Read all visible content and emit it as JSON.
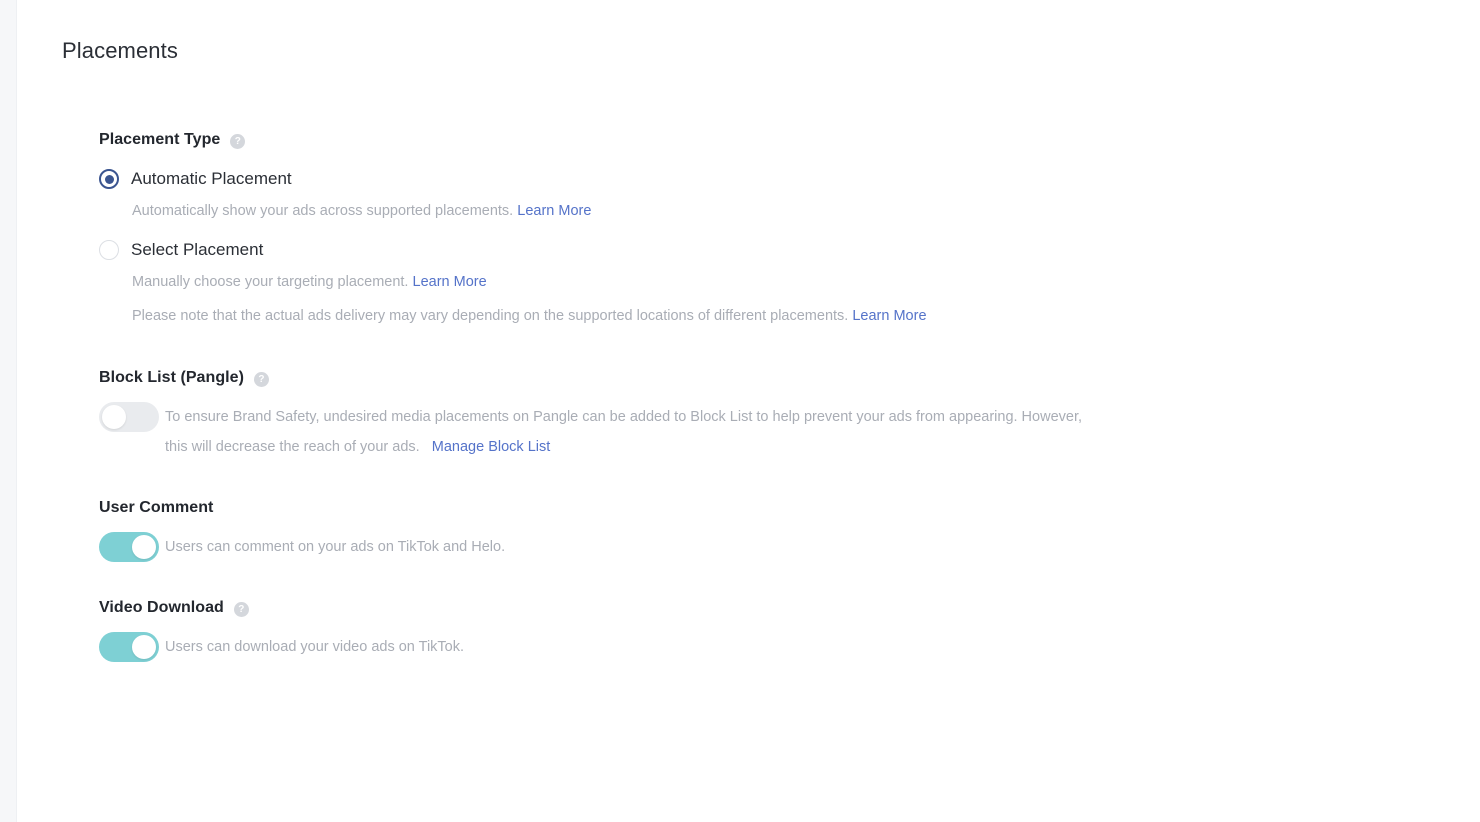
{
  "section": {
    "title": "Placements"
  },
  "placement_type": {
    "label": "Placement Type",
    "help_icon": "help-circle-icon",
    "options": [
      {
        "label": "Automatic Placement",
        "selected": true,
        "hint_text": "Automatically show your ads across supported placements.",
        "hint_link": "Learn More"
      },
      {
        "label": "Select Placement",
        "selected": false,
        "hint_text": "Manually choose your targeting placement.",
        "hint_link": "Learn More"
      }
    ],
    "note_text": "Please note that the actual ads delivery may vary depending on the supported locations of different placements.",
    "note_link": "Learn More"
  },
  "block_list": {
    "label": "Block List (Pangle)",
    "help_icon": "help-circle-icon",
    "toggle_state": "off",
    "description_line1": "To ensure Brand Safety, undesired media placements on Pangle can be added to Block List to help prevent your ads from appearing. However,",
    "description_line2": "this will decrease the reach of your ads.",
    "manage_link": "Manage Block List"
  },
  "user_comment": {
    "label": "User Comment",
    "toggle_state": "on",
    "description": "Users can comment on your ads on TikTok and Helo."
  },
  "video_download": {
    "label": "Video Download",
    "help_icon": "help-circle-icon",
    "toggle_state": "on",
    "description": "Users can download your video ads on TikTok."
  },
  "colors": {
    "radio_selected": "#3b5590",
    "link": "#5573c9",
    "toggle_on": "#7ed0d4",
    "toggle_off": "#e9ebee",
    "hint_text": "#a9adb5",
    "heading": "#23272e"
  },
  "glyphs": {
    "question_mark": "?"
  }
}
